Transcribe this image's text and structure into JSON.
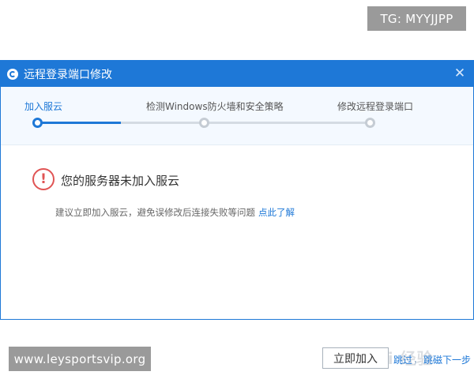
{
  "overlays": {
    "top_tag": "TG: MYYJJPP",
    "bottom_tag": "www.leysportsvip.org"
  },
  "window": {
    "title": "远程登录端口修改",
    "app_icon": "s-logo-icon",
    "close_glyph": "✕",
    "accent_color": "#1e78d7"
  },
  "steps": {
    "items": [
      {
        "label": "加入服云",
        "state": "active"
      },
      {
        "label": "检测Windows防火墙和安全策略",
        "state": "pending"
      },
      {
        "label": "修改远程登录端口",
        "state": "pending"
      }
    ],
    "progress_fraction": 0.25
  },
  "warning": {
    "icon_glyph": "!",
    "title": "您的服务器未加入服云",
    "description": "建议立即加入服云，避免误修改后连接失败等问题",
    "learn_more": "点此了解",
    "color": "#e05454"
  },
  "footer": {
    "join_button": "立即加入",
    "skip_label": "跳过",
    "separator": "，",
    "next_label": "跳磁下一步"
  },
  "watermark": "Bai 经验"
}
